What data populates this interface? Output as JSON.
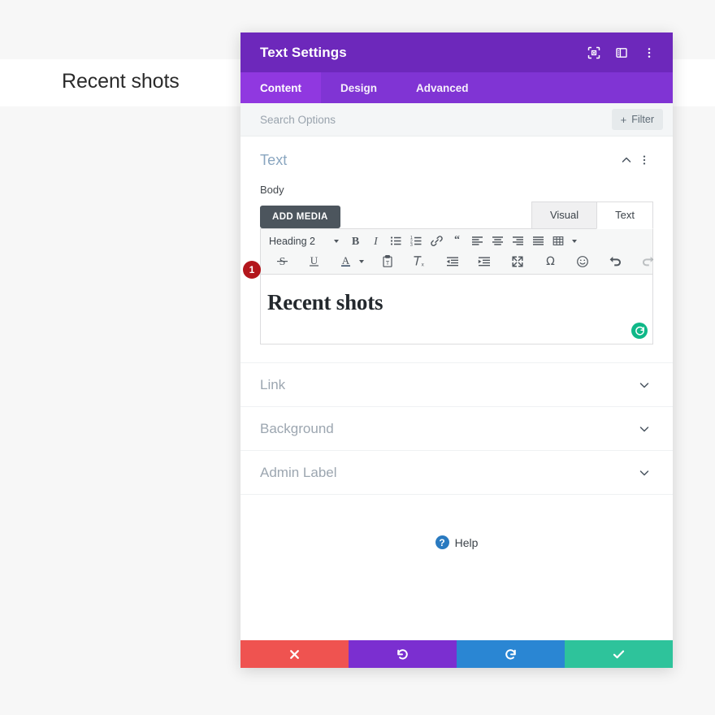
{
  "page": {
    "heading": "Recent shots"
  },
  "modal": {
    "title": "Text Settings",
    "header_icons": [
      {
        "name": "focus-icon",
        "label": "Focus"
      },
      {
        "name": "panel-layout-icon",
        "label": "Layout"
      },
      {
        "name": "more-vertical-icon",
        "label": "More options"
      }
    ],
    "tabs": [
      {
        "label": "Content",
        "active": true
      },
      {
        "label": "Design",
        "active": false
      },
      {
        "label": "Advanced",
        "active": false
      }
    ],
    "search": {
      "placeholder": "Search Options",
      "value": ""
    },
    "filter": {
      "label": "Filter",
      "plus": "+"
    },
    "text_section": {
      "title": "Text",
      "collapse_icon": "chevron-up-icon",
      "menu_icon": "more-vertical-icon",
      "field_label": "Body",
      "add_media_label": "ADD MEDIA",
      "editor_tabs": [
        {
          "label": "Visual",
          "active": false
        },
        {
          "label": "Text",
          "active": true
        }
      ],
      "format_select": "Heading 2",
      "toolbar_row_1": [
        "bold-icon",
        "italic-icon",
        "bulleted-list-icon",
        "numbered-list-icon",
        "link-icon",
        "blockquote-icon",
        "align-left-icon",
        "align-center-icon",
        "align-right-icon",
        "align-justify-icon",
        "table-icon"
      ],
      "toolbar_row_2": [
        "strikethrough-icon",
        "underline-icon",
        "text-color-icon",
        "paste-as-text-icon",
        "clear-formatting-icon",
        "outdent-icon",
        "indent-icon",
        "fullscreen-icon",
        "special-character-icon",
        "emoji-icon",
        "undo-icon",
        "redo-icon"
      ],
      "editor_content": "Recent shots",
      "badge": "1",
      "refresh_icon": "refresh-icon"
    },
    "sections": [
      {
        "title": "Link",
        "icon": "chevron-down-icon"
      },
      {
        "title": "Background",
        "icon": "chevron-down-icon"
      },
      {
        "title": "Admin Label",
        "icon": "chevron-down-icon"
      }
    ],
    "help": {
      "label": "Help",
      "icon": "question-mark-icon",
      "mark": "?"
    },
    "footer": [
      {
        "name": "cancel-button",
        "icon": "close-icon",
        "color": "#ef5350"
      },
      {
        "name": "undo-button",
        "icon": "undo-icon",
        "color": "#7b2fd0"
      },
      {
        "name": "redo-button",
        "icon": "redo-icon",
        "color": "#2a86d3"
      },
      {
        "name": "save-button",
        "icon": "check-icon",
        "color": "#2ec39b"
      }
    ]
  },
  "colors": {
    "header_purple": "#6d28bb",
    "tabs_purple": "#8034d4",
    "tab_active_purple": "#9038e0",
    "badge_red": "#b3161c",
    "refresh_green": "#0fb888",
    "help_blue": "#2a7ac0"
  }
}
